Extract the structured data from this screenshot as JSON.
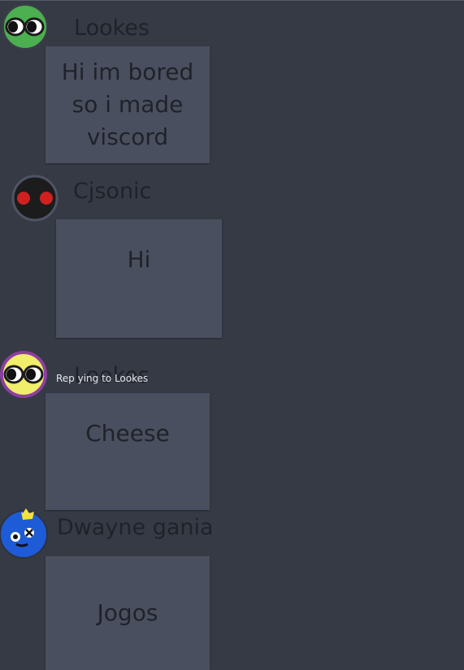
{
  "messages": [
    {
      "author": "Lookes",
      "text": "Hi im bored\nso i made\nviscord",
      "avatar_icon": "green-eyes-avatar-icon",
      "avatar_color": "#4caf50"
    },
    {
      "author": "Cjsonic",
      "text": "Hi",
      "avatar_icon": "black-red-eyes-avatar-icon",
      "avatar_color": "#1c1c1c"
    },
    {
      "author": "Lookes",
      "text": "Cheese",
      "reply_label": "Rep ying to Lookes",
      "avatar_icon": "yellow-eyes-avatar-icon",
      "avatar_color": "#f0ee6a"
    },
    {
      "author": "Dwayne gania",
      "text": "Jogos",
      "avatar_icon": "blue-creature-avatar-icon",
      "avatar_color": "#1e5bd6"
    }
  ]
}
